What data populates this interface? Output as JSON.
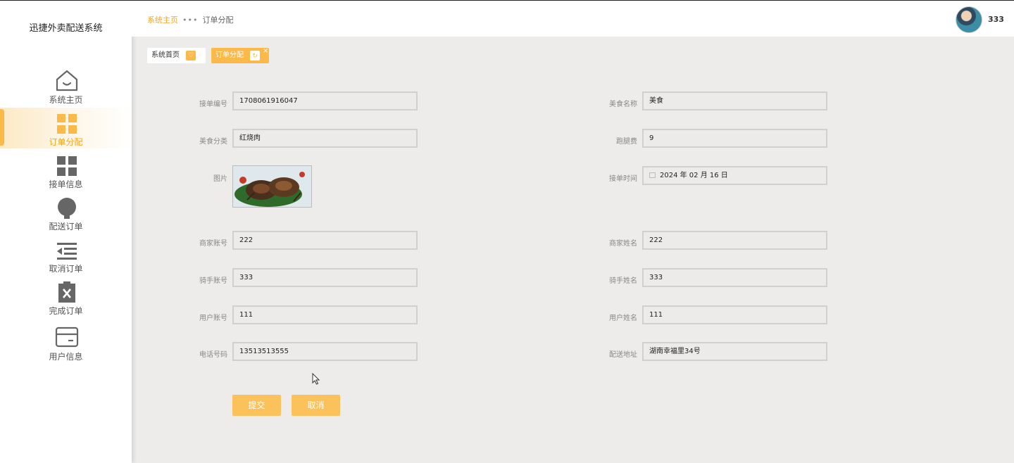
{
  "app": {
    "title": "迅捷外卖配送系统"
  },
  "sidebar": {
    "items": [
      {
        "label": "系统主页",
        "icon": "home-icon"
      },
      {
        "label": "订单分配",
        "icon": "grid-icon"
      },
      {
        "label": "接单信息",
        "icon": "grid-icon"
      },
      {
        "label": "配送订单",
        "icon": "bulb-icon"
      },
      {
        "label": "取消订单",
        "icon": "list-indent-icon"
      },
      {
        "label": "完成订单",
        "icon": "clipboard-x-icon"
      },
      {
        "label": "用户信息",
        "icon": "card-icon"
      }
    ],
    "active_index": 1
  },
  "header": {
    "breadcrumb_home": "系统主页",
    "breadcrumb_current": "订单分配",
    "user_name": "333"
  },
  "tabs": [
    {
      "label": "系统首页"
    },
    {
      "label": "订单分配"
    }
  ],
  "form": {
    "order_no_label": "接单编号",
    "order_no": "1708061916047",
    "food_name_label": "美食名称",
    "food_name": "美食",
    "food_category_label": "美食分类",
    "food_category": "红烧肉",
    "delivery_fee_label": "跑腿费",
    "delivery_fee": "9",
    "image_label": "图片",
    "order_time_label": "接单时间",
    "order_time": "2024 年 02 月 16 日",
    "merchant_account_label": "商家账号",
    "merchant_account": "222",
    "merchant_name_label": "商家姓名",
    "merchant_name": "222",
    "rider_account_label": "骑手账号",
    "rider_account": "333",
    "rider_name_label": "骑手姓名",
    "rider_name": "333",
    "user_account_label": "用户账号",
    "user_account": "111",
    "user_name_label": "用户姓名",
    "user_name": "111",
    "phone_label": "电话号码",
    "phone": "13513513555",
    "address_label": "配送地址",
    "address": "湖南幸福里34号"
  },
  "buttons": {
    "submit": "提交",
    "cancel": "取消"
  },
  "colors": {
    "accent": "#fbb94a",
    "accent_text": "#f5a623",
    "background": "#edecea"
  }
}
